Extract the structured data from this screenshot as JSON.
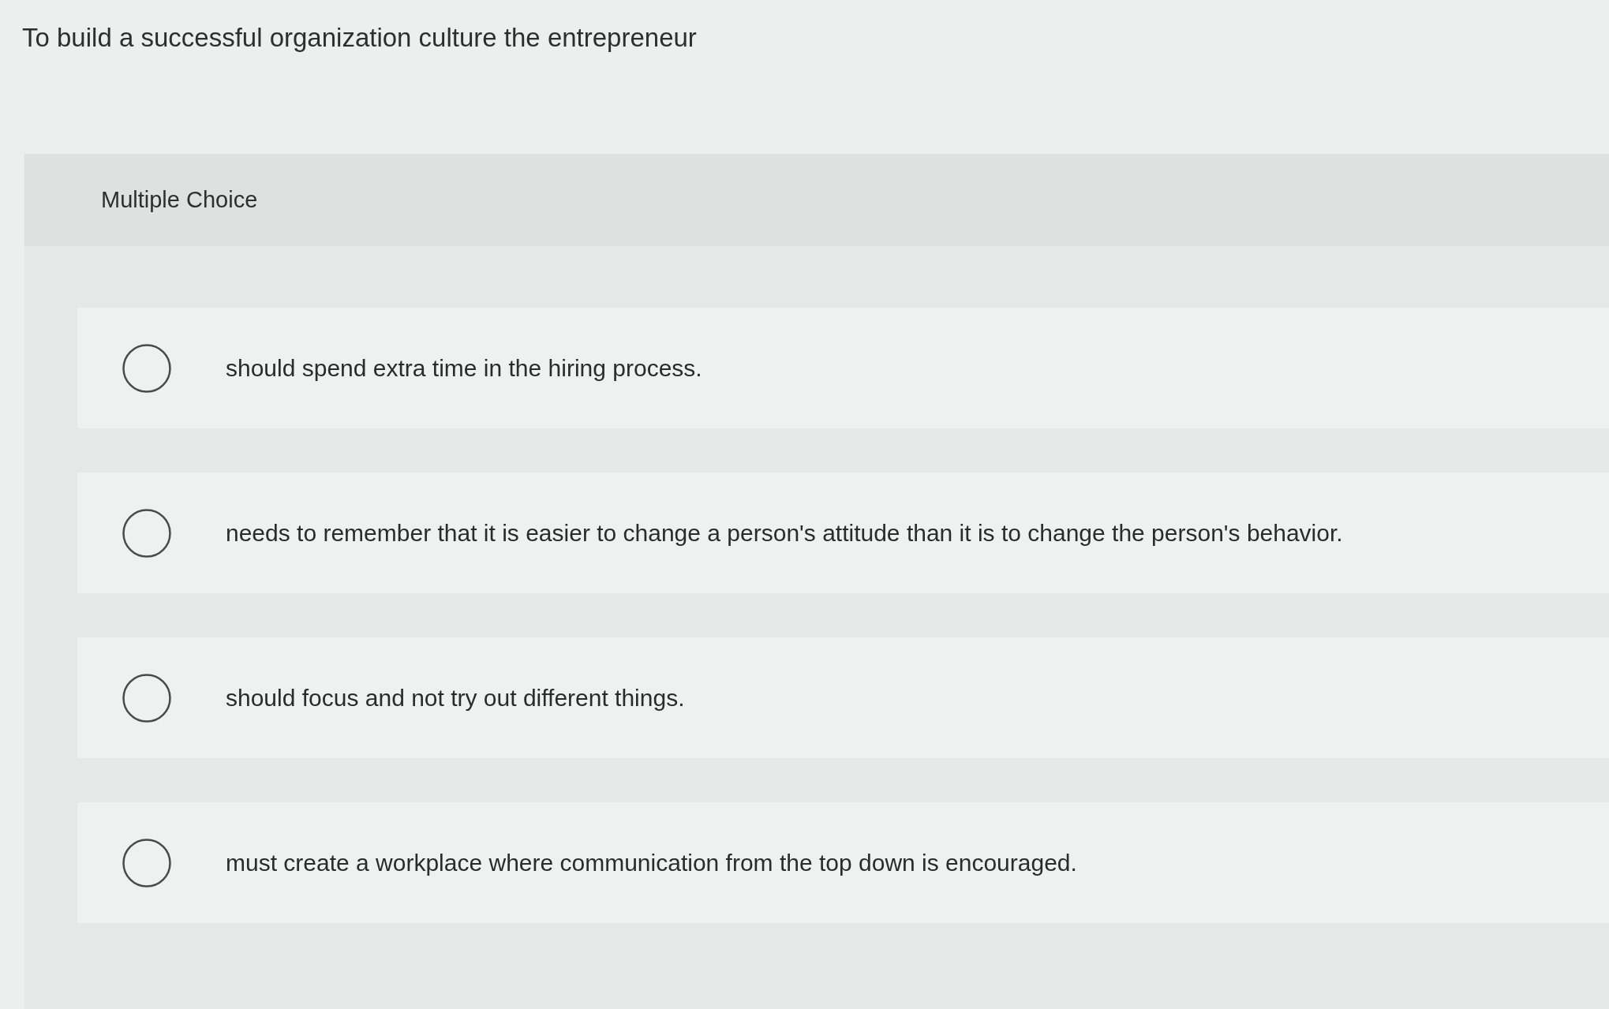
{
  "question": {
    "text": "To build a successful organization culture the entrepreneur"
  },
  "answer_panel": {
    "heading": "Multiple Choice",
    "options": [
      {
        "text": "should spend extra time in the hiring process.",
        "selected": false
      },
      {
        "text": "needs to remember that it is easier to change a person's attitude than it is to change the person's behavior.",
        "selected": false
      },
      {
        "text": "should focus and not try out different things.",
        "selected": false
      },
      {
        "text": "must create a workplace where communication from the top down is encouraged.",
        "selected": false
      }
    ]
  }
}
